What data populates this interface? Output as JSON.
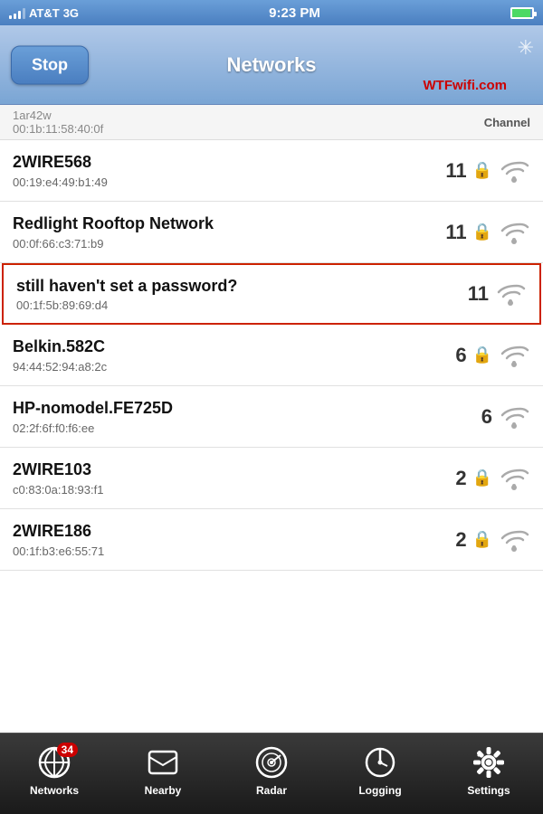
{
  "statusBar": {
    "carrier": "AT&T",
    "networkType": "3G",
    "time": "9:23 PM"
  },
  "navBar": {
    "stopLabel": "Stop",
    "title": "Networks",
    "wtfLogo": "WTFwifi.com"
  },
  "partialRow": {
    "ssid": "1ar42w",
    "mac": "00:1b:11:58:40:0f",
    "channelHeader": "Channel"
  },
  "networks": [
    {
      "id": 1,
      "name": "2WIRE568",
      "mac": "00:19:e4:49:b1:49",
      "channel": "11",
      "locked": true,
      "highlighted": false
    },
    {
      "id": 2,
      "name": "Redlight Rooftop Network",
      "mac": "00:0f:66:c3:71:b9",
      "channel": "11",
      "locked": true,
      "highlighted": false
    },
    {
      "id": 3,
      "name": "still haven't set a password?",
      "mac": "00:1f:5b:89:69:d4",
      "channel": "11",
      "locked": false,
      "highlighted": true
    },
    {
      "id": 4,
      "name": "Belkin.582C",
      "mac": "94:44:52:94:a8:2c",
      "channel": "6",
      "locked": true,
      "highlighted": false
    },
    {
      "id": 5,
      "name": "HP-nomodel.FE725D",
      "mac": "02:2f:6f:f0:f6:ee",
      "channel": "6",
      "locked": false,
      "highlighted": false
    },
    {
      "id": 6,
      "name": "2WIRE103",
      "mac": "c0:83:0a:18:93:f1",
      "channel": "2",
      "locked": true,
      "highlighted": false
    },
    {
      "id": 7,
      "name": "2WIRE186",
      "mac": "00:1f:b3:e6:55:71",
      "channel": "2",
      "locked": true,
      "highlighted": false
    }
  ],
  "tabBar": {
    "tabs": [
      {
        "id": "networks",
        "label": "Networks",
        "badge": "34",
        "active": true
      },
      {
        "id": "nearby",
        "label": "Nearby",
        "badge": null,
        "active": false
      },
      {
        "id": "radar",
        "label": "Radar",
        "badge": null,
        "active": false
      },
      {
        "id": "logging",
        "label": "Logging",
        "badge": null,
        "active": false
      },
      {
        "id": "settings",
        "label": "Settings",
        "badge": null,
        "active": false
      }
    ]
  }
}
